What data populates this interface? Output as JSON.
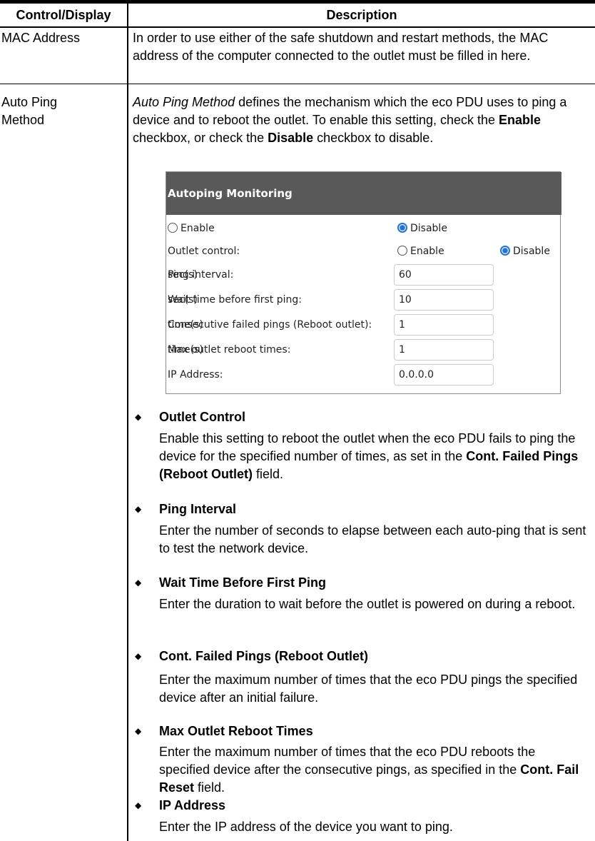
{
  "table": {
    "headers": [
      "Control/Display",
      "Description"
    ],
    "rows": [
      {
        "label": "MAC Address",
        "description": "In order to use either of the safe shutdown and restart methods, the MAC address of the computer connected to the outlet must be filled in here."
      },
      {
        "label_line1": "Auto Ping",
        "label_line2": "Method",
        "intro_italic": "Auto Ping Method",
        "intro_part1": " defines the mechanism which the eco PDU uses to ping a device and to reboot the outlet. To enable this setting, check the ",
        "intro_enable": "Enable",
        "intro_part2": " checkbox, or check the ",
        "intro_disable": "Disable",
        "intro_part3": " checkbox to disable."
      }
    ]
  },
  "screenshot": {
    "title": "Autoping Monitoring",
    "enable_label": "Enable",
    "disable_label": "Disable",
    "selected": "Disable",
    "outlet_control": {
      "label": "Outlet control:",
      "enable_label": "Enable",
      "disable_label": "Disable",
      "selected": "Disable"
    },
    "fields": [
      {
        "label": "Ping interval:",
        "value": "60",
        "unit": "sec(s)"
      },
      {
        "label": "Wait time before first ping:",
        "value": "10",
        "unit": "sec(s)"
      },
      {
        "label": "Consecutive failed pings (Reboot outlet):",
        "value": "1",
        "unit": "time(s)"
      },
      {
        "label": "Max outlet reboot times:",
        "value": "1",
        "unit": "time(s)"
      },
      {
        "label": "IP Address:",
        "value": "0.0.0.0",
        "unit": ""
      }
    ]
  },
  "bullets": [
    {
      "title": "Outlet Control",
      "body": "Enable this setting to reboot the outlet when the eco PDU fails to ping the device for the specified number of times, as set in the ",
      "bold_ref": "Cont. Failed Pings (Reboot Outlet)",
      "body_after": " field."
    },
    {
      "title": "Ping Interval",
      "body": "Enter the number of seconds to elapse between each auto-ping that is sent to test the network device."
    },
    {
      "title": "Wait Time Before First Ping",
      "body": "Enter the duration to wait before the outlet is powered on during a reboot."
    },
    {
      "title": "Cont. Failed Pings (Reboot Outlet)",
      "body": "Enter the maximum number of times that the eco PDU pings the specified device after an initial failure."
    },
    {
      "title": "Max Outlet Reboot Times",
      "body": "Enter the maximum number of times that the eco PDU reboots the specified device after the consecutive pings, as specified in the ",
      "bold_ref": "Cont. Fail Reset",
      "body_after": " field."
    },
    {
      "title": "IP Address",
      "body": "Enter the IP address of the device you want to ping."
    }
  ],
  "bullet_symbol": "◆"
}
